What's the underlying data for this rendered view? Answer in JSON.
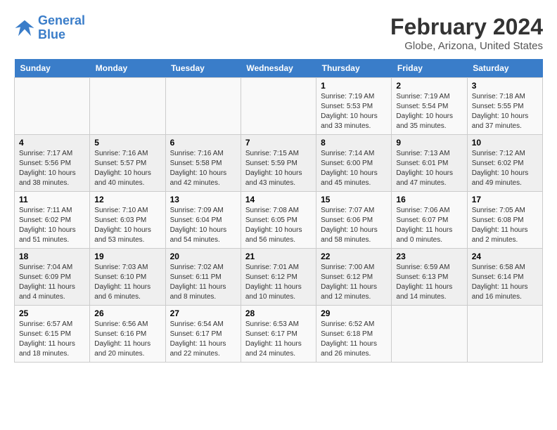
{
  "header": {
    "logo_line1": "General",
    "logo_line2": "Blue",
    "title": "February 2024",
    "subtitle": "Globe, Arizona, United States"
  },
  "weekdays": [
    "Sunday",
    "Monday",
    "Tuesday",
    "Wednesday",
    "Thursday",
    "Friday",
    "Saturday"
  ],
  "weeks": [
    [
      {
        "day": "",
        "info": ""
      },
      {
        "day": "",
        "info": ""
      },
      {
        "day": "",
        "info": ""
      },
      {
        "day": "",
        "info": ""
      },
      {
        "day": "1",
        "info": "Sunrise: 7:19 AM\nSunset: 5:53 PM\nDaylight: 10 hours\nand 33 minutes."
      },
      {
        "day": "2",
        "info": "Sunrise: 7:19 AM\nSunset: 5:54 PM\nDaylight: 10 hours\nand 35 minutes."
      },
      {
        "day": "3",
        "info": "Sunrise: 7:18 AM\nSunset: 5:55 PM\nDaylight: 10 hours\nand 37 minutes."
      }
    ],
    [
      {
        "day": "4",
        "info": "Sunrise: 7:17 AM\nSunset: 5:56 PM\nDaylight: 10 hours\nand 38 minutes."
      },
      {
        "day": "5",
        "info": "Sunrise: 7:16 AM\nSunset: 5:57 PM\nDaylight: 10 hours\nand 40 minutes."
      },
      {
        "day": "6",
        "info": "Sunrise: 7:16 AM\nSunset: 5:58 PM\nDaylight: 10 hours\nand 42 minutes."
      },
      {
        "day": "7",
        "info": "Sunrise: 7:15 AM\nSunset: 5:59 PM\nDaylight: 10 hours\nand 43 minutes."
      },
      {
        "day": "8",
        "info": "Sunrise: 7:14 AM\nSunset: 6:00 PM\nDaylight: 10 hours\nand 45 minutes."
      },
      {
        "day": "9",
        "info": "Sunrise: 7:13 AM\nSunset: 6:01 PM\nDaylight: 10 hours\nand 47 minutes."
      },
      {
        "day": "10",
        "info": "Sunrise: 7:12 AM\nSunset: 6:02 PM\nDaylight: 10 hours\nand 49 minutes."
      }
    ],
    [
      {
        "day": "11",
        "info": "Sunrise: 7:11 AM\nSunset: 6:02 PM\nDaylight: 10 hours\nand 51 minutes."
      },
      {
        "day": "12",
        "info": "Sunrise: 7:10 AM\nSunset: 6:03 PM\nDaylight: 10 hours\nand 53 minutes."
      },
      {
        "day": "13",
        "info": "Sunrise: 7:09 AM\nSunset: 6:04 PM\nDaylight: 10 hours\nand 54 minutes."
      },
      {
        "day": "14",
        "info": "Sunrise: 7:08 AM\nSunset: 6:05 PM\nDaylight: 10 hours\nand 56 minutes."
      },
      {
        "day": "15",
        "info": "Sunrise: 7:07 AM\nSunset: 6:06 PM\nDaylight: 10 hours\nand 58 minutes."
      },
      {
        "day": "16",
        "info": "Sunrise: 7:06 AM\nSunset: 6:07 PM\nDaylight: 11 hours\nand 0 minutes."
      },
      {
        "day": "17",
        "info": "Sunrise: 7:05 AM\nSunset: 6:08 PM\nDaylight: 11 hours\nand 2 minutes."
      }
    ],
    [
      {
        "day": "18",
        "info": "Sunrise: 7:04 AM\nSunset: 6:09 PM\nDaylight: 11 hours\nand 4 minutes."
      },
      {
        "day": "19",
        "info": "Sunrise: 7:03 AM\nSunset: 6:10 PM\nDaylight: 11 hours\nand 6 minutes."
      },
      {
        "day": "20",
        "info": "Sunrise: 7:02 AM\nSunset: 6:11 PM\nDaylight: 11 hours\nand 8 minutes."
      },
      {
        "day": "21",
        "info": "Sunrise: 7:01 AM\nSunset: 6:12 PM\nDaylight: 11 hours\nand 10 minutes."
      },
      {
        "day": "22",
        "info": "Sunrise: 7:00 AM\nSunset: 6:12 PM\nDaylight: 11 hours\nand 12 minutes."
      },
      {
        "day": "23",
        "info": "Sunrise: 6:59 AM\nSunset: 6:13 PM\nDaylight: 11 hours\nand 14 minutes."
      },
      {
        "day": "24",
        "info": "Sunrise: 6:58 AM\nSunset: 6:14 PM\nDaylight: 11 hours\nand 16 minutes."
      }
    ],
    [
      {
        "day": "25",
        "info": "Sunrise: 6:57 AM\nSunset: 6:15 PM\nDaylight: 11 hours\nand 18 minutes."
      },
      {
        "day": "26",
        "info": "Sunrise: 6:56 AM\nSunset: 6:16 PM\nDaylight: 11 hours\nand 20 minutes."
      },
      {
        "day": "27",
        "info": "Sunrise: 6:54 AM\nSunset: 6:17 PM\nDaylight: 11 hours\nand 22 minutes."
      },
      {
        "day": "28",
        "info": "Sunrise: 6:53 AM\nSunset: 6:17 PM\nDaylight: 11 hours\nand 24 minutes."
      },
      {
        "day": "29",
        "info": "Sunrise: 6:52 AM\nSunset: 6:18 PM\nDaylight: 11 hours\nand 26 minutes."
      },
      {
        "day": "",
        "info": ""
      },
      {
        "day": "",
        "info": ""
      }
    ]
  ]
}
